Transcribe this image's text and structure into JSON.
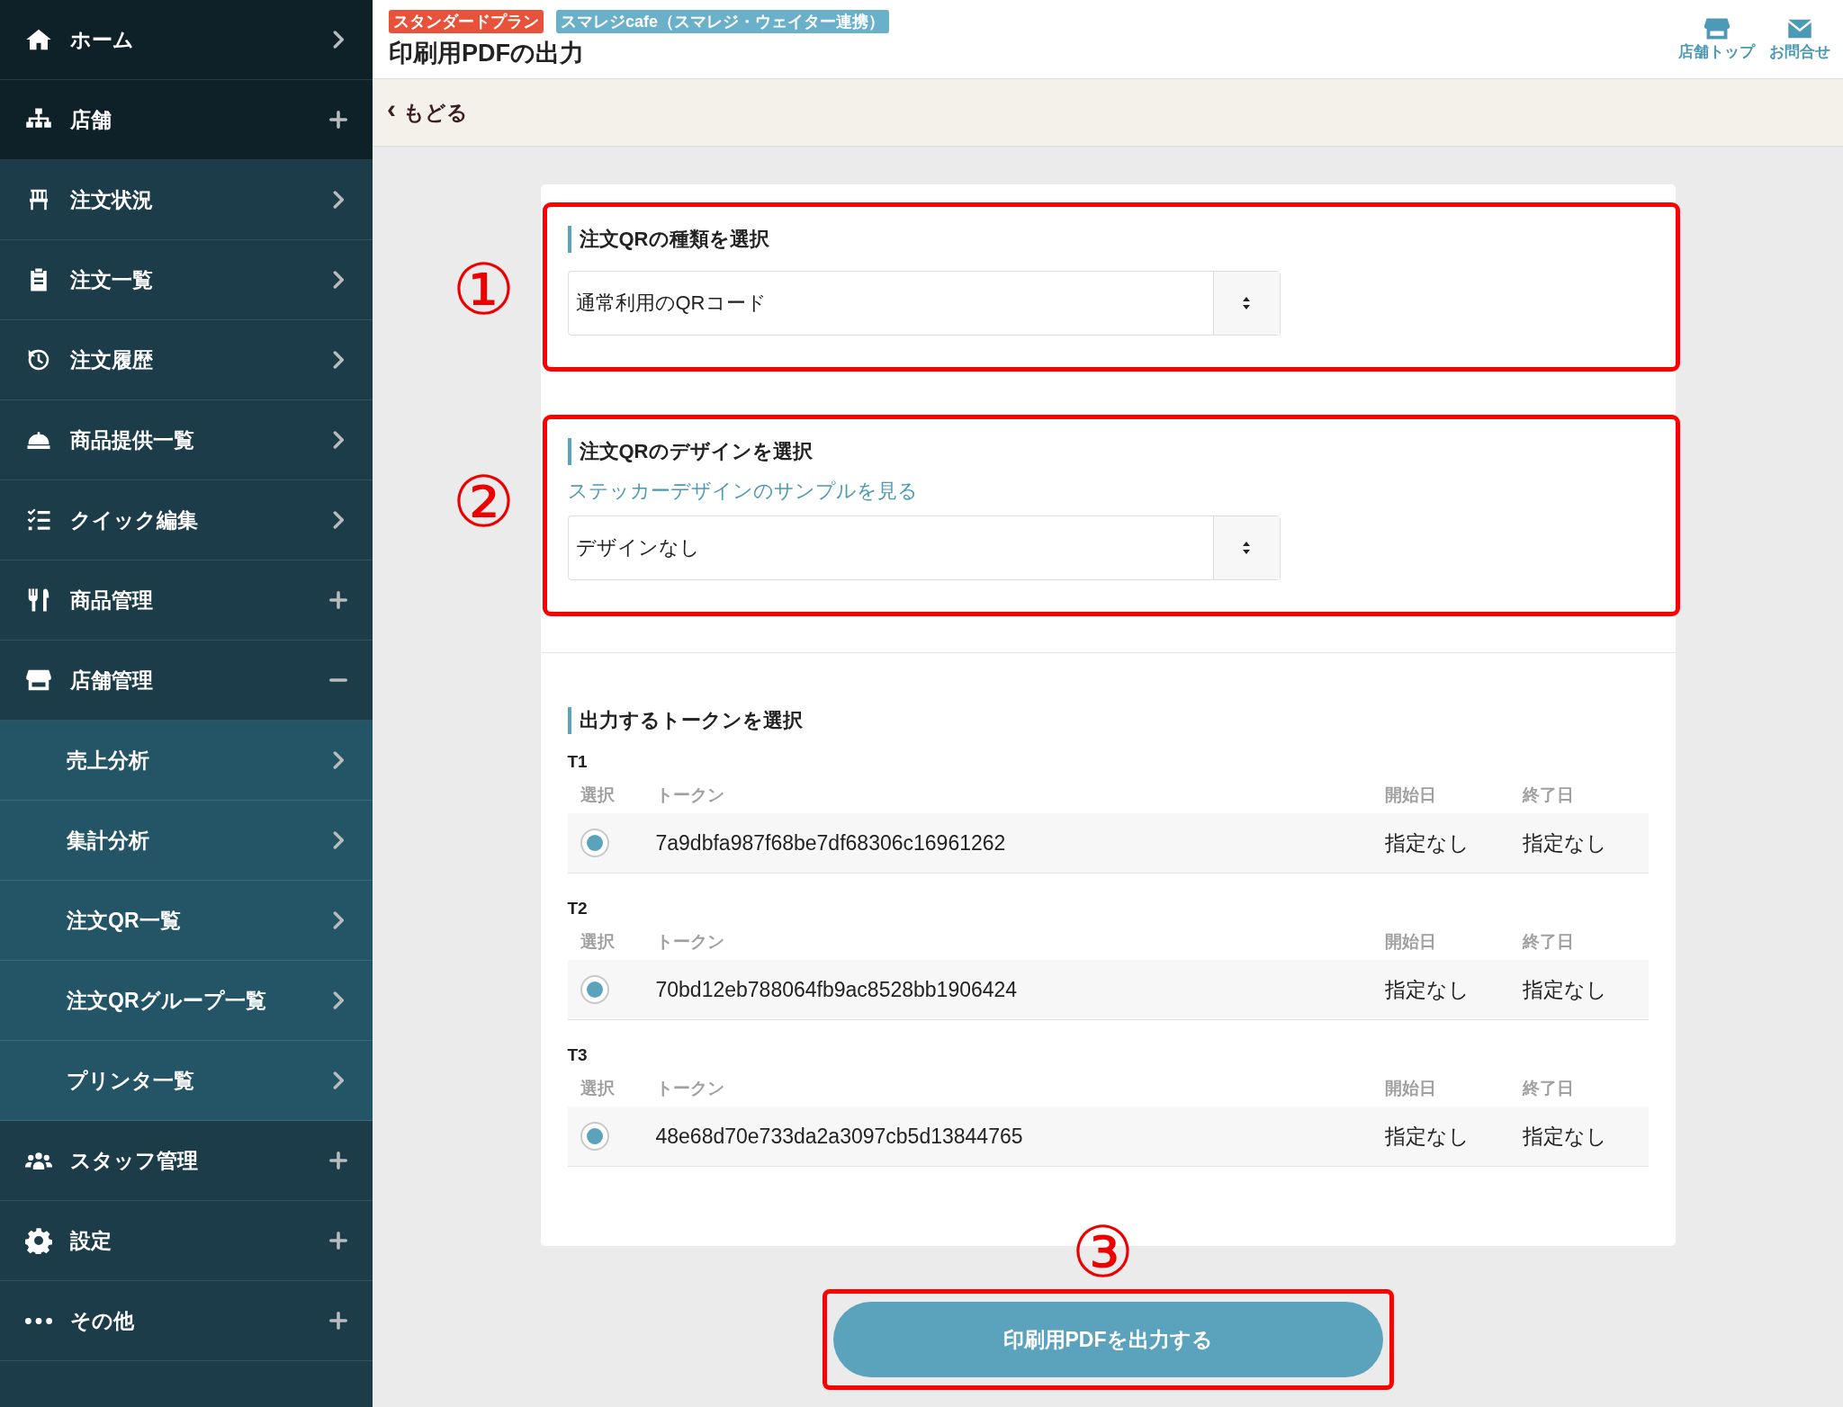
{
  "sidebar": {
    "items": [
      {
        "label": "ホーム",
        "kind": "primary"
      },
      {
        "label": "店舗",
        "kind": "primary",
        "expanded": false
      },
      {
        "label": "注文状況",
        "kind": "menu"
      },
      {
        "label": "注文一覧",
        "kind": "menu"
      },
      {
        "label": "注文履歴",
        "kind": "menu"
      },
      {
        "label": "商品提供一覧",
        "kind": "menu"
      },
      {
        "label": "クイック編集",
        "kind": "menu"
      },
      {
        "label": "商品管理",
        "kind": "menu",
        "expanded": false
      },
      {
        "label": "店舗管理",
        "kind": "menu",
        "expanded": true,
        "children": [
          {
            "label": "売上分析"
          },
          {
            "label": "集計分析"
          },
          {
            "label": "注文QR一覧"
          },
          {
            "label": "注文QRグループ一覧"
          },
          {
            "label": "プリンタ一覧"
          }
        ]
      },
      {
        "label": "スタッフ管理",
        "kind": "menu",
        "expanded": false
      },
      {
        "label": "設定",
        "kind": "menu",
        "expanded": false
      },
      {
        "label": "その他",
        "kind": "menu",
        "expanded": false
      }
    ]
  },
  "header": {
    "badges": [
      {
        "text": "スタンダードプラン",
        "color": "#e8513a"
      },
      {
        "text": "スマレジcafe（スマレジ・ウェイター連携）",
        "color": "#6ab0c8"
      }
    ],
    "title": "印刷用PDFの出力",
    "actions": [
      {
        "label": "店舗トップ"
      },
      {
        "label": "お問合せ"
      }
    ]
  },
  "back_link": {
    "icon": "‹",
    "label": "もどる"
  },
  "sections": [
    {
      "marker": "①",
      "title": "注文QRの種類を選択",
      "select": {
        "value": "通常利用のQRコード"
      }
    },
    {
      "marker": "②",
      "title": "注文QRのデザインを選択",
      "link": "ステッカーデザインのサンプルを見る",
      "select": {
        "value": "デザインなし"
      }
    }
  ],
  "tokens": {
    "title": "出力するトークンを選択",
    "groups": [
      {
        "name": "T1",
        "columns": [
          "選択",
          "トークン",
          "開始日",
          "終了日"
        ],
        "row": {
          "selected": true,
          "token": "7a9dbfa987f68be7df68306c16961262",
          "start": "指定なし",
          "end": "指定なし"
        }
      },
      {
        "name": "T2",
        "columns": [
          "選択",
          "トークン",
          "開始日",
          "終了日"
        ],
        "row": {
          "selected": true,
          "token": "70bd12eb788064fb9ac8528bb1906424",
          "start": "指定なし",
          "end": "指定なし"
        }
      },
      {
        "name": "T3",
        "columns": [
          "選択",
          "トークン",
          "開始日",
          "終了日"
        ],
        "row": {
          "selected": true,
          "token": "48e68d70e733da2a3097cb5d13844765",
          "start": "指定なし",
          "end": "指定なし"
        }
      }
    ]
  },
  "submit": {
    "marker": "③",
    "label": "印刷用PDFを出力する"
  }
}
